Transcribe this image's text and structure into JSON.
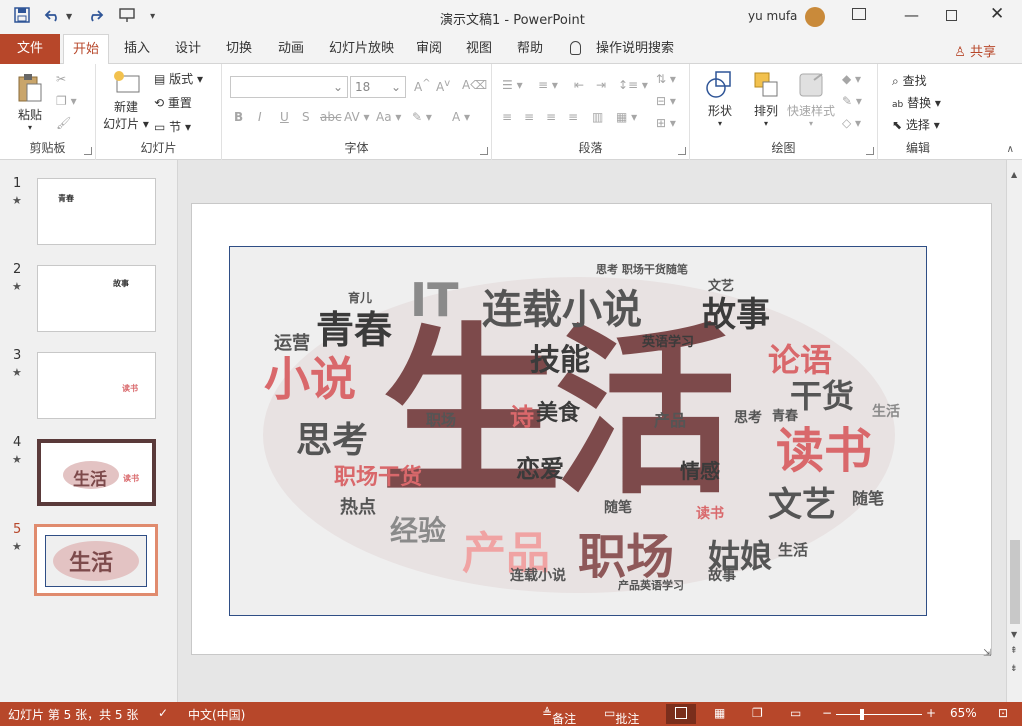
{
  "titlebar": {
    "doc_title": "演示文稿1  -  PowerPoint",
    "user_name": "yu mufa",
    "qat": {
      "save": "save-icon",
      "undo": "undo-icon",
      "redo": "redo-icon",
      "present": "present-icon",
      "customize": "customize-icon"
    }
  },
  "tabs": {
    "file": "文件",
    "items": [
      "开始",
      "插入",
      "设计",
      "切换",
      "动画",
      "幻灯片放映",
      "审阅",
      "视图",
      "帮助"
    ],
    "tell_me": "操作说明搜索",
    "share": "共享"
  },
  "ribbon": {
    "clipboard": {
      "paste": "粘贴",
      "label": "剪贴板"
    },
    "slides": {
      "new_slide_line1": "新建",
      "new_slide_line2": "幻灯片",
      "layout": "版式",
      "reset": "重置",
      "section": "节",
      "label": "幻灯片"
    },
    "font": {
      "font_size": "18",
      "label": "字体",
      "bold": "B",
      "italic": "I",
      "underline": "U",
      "strike": "S",
      "strike_text": "abc",
      "spacing": "AV",
      "case": "Aa",
      "color": "A"
    },
    "paragraph": {
      "label": "段落"
    },
    "drawing": {
      "shapes": "形状",
      "arrange": "排列",
      "quick_styles": "快速样式",
      "label": "绘图"
    },
    "editing": {
      "find": "查找",
      "replace": "替换",
      "select": "选择",
      "label": "编辑"
    }
  },
  "thumbnails": [
    {
      "num": "1",
      "star": "★",
      "text": "青春"
    },
    {
      "num": "2",
      "star": "★",
      "text": "故事"
    },
    {
      "num": "3",
      "star": "★",
      "text": "读书"
    },
    {
      "num": "4",
      "star": "★",
      "text_main": "生活",
      "text_side": "读书"
    },
    {
      "num": "5",
      "star": "★",
      "text_main": "生活"
    }
  ],
  "wordcloud": {
    "main": "生活",
    "words": [
      {
        "t": "连载小说",
        "c": "#555555"
      },
      {
        "t": "IT",
        "c": "#8a8a8a"
      },
      {
        "t": "青春",
        "c": "#3b3b3b"
      },
      {
        "t": "故事",
        "c": "#3b3b3b"
      },
      {
        "t": "小说",
        "c": "#d9686b"
      },
      {
        "t": "技能",
        "c": "#3b3b3b"
      },
      {
        "t": "论语",
        "c": "#d9686b"
      },
      {
        "t": "干货",
        "c": "#555555"
      },
      {
        "t": "思考",
        "c": "#555555"
      },
      {
        "t": "读书",
        "c": "#d9686b"
      },
      {
        "t": "诗",
        "c": "#d9686b"
      },
      {
        "t": "美食",
        "c": "#3b3b3b"
      },
      {
        "t": "恋爱",
        "c": "#3b3b3b"
      },
      {
        "t": "情感",
        "c": "#3b3b3b"
      },
      {
        "t": "职场干货",
        "c": "#d9686b"
      },
      {
        "t": "文艺",
        "c": "#555555"
      },
      {
        "t": "经验",
        "c": "#8a8a8a"
      },
      {
        "t": "产品",
        "c": "#f0a3a3"
      },
      {
        "t": "职场",
        "c": "#8e5859"
      },
      {
        "t": "姑娘",
        "c": "#555555"
      },
      {
        "t": "热点",
        "c": "#555555"
      },
      {
        "t": "随笔",
        "c": "#555555"
      },
      {
        "t": "连载小说",
        "c": "#555555"
      },
      {
        "t": "产品英语学习",
        "c": "#555555"
      },
      {
        "t": "故事",
        "c": "#555555"
      },
      {
        "t": "运营",
        "c": "#555555"
      },
      {
        "t": "育儿",
        "c": "#555555"
      },
      {
        "t": "思考 职场干货随笔",
        "c": "#555555"
      },
      {
        "t": "文艺",
        "c": "#555555"
      },
      {
        "t": "英语学习",
        "c": "#3b3b3b"
      },
      {
        "t": "产品",
        "c": "#555555"
      },
      {
        "t": "职场",
        "c": "#555555"
      },
      {
        "t": "生活",
        "c": "#555555"
      },
      {
        "t": "青春",
        "c": "#555555"
      },
      {
        "t": "随笔",
        "c": "#555555"
      },
      {
        "t": "读书",
        "c": "#d9686b"
      },
      {
        "t": "生活",
        "c": "#8a8a8a"
      },
      {
        "t": "思考",
        "c": "#555555"
      }
    ]
  },
  "statusbar": {
    "slide_info": "幻灯片 第 5 张，共 5 张",
    "language": "中文(中国)",
    "notes": "备注",
    "comments": "批注",
    "zoom": "65%"
  },
  "colors": {
    "accent": "#b7472a",
    "wordcloud_main": "#7d4a4b",
    "wordcloud_pink": "#d9686b"
  }
}
